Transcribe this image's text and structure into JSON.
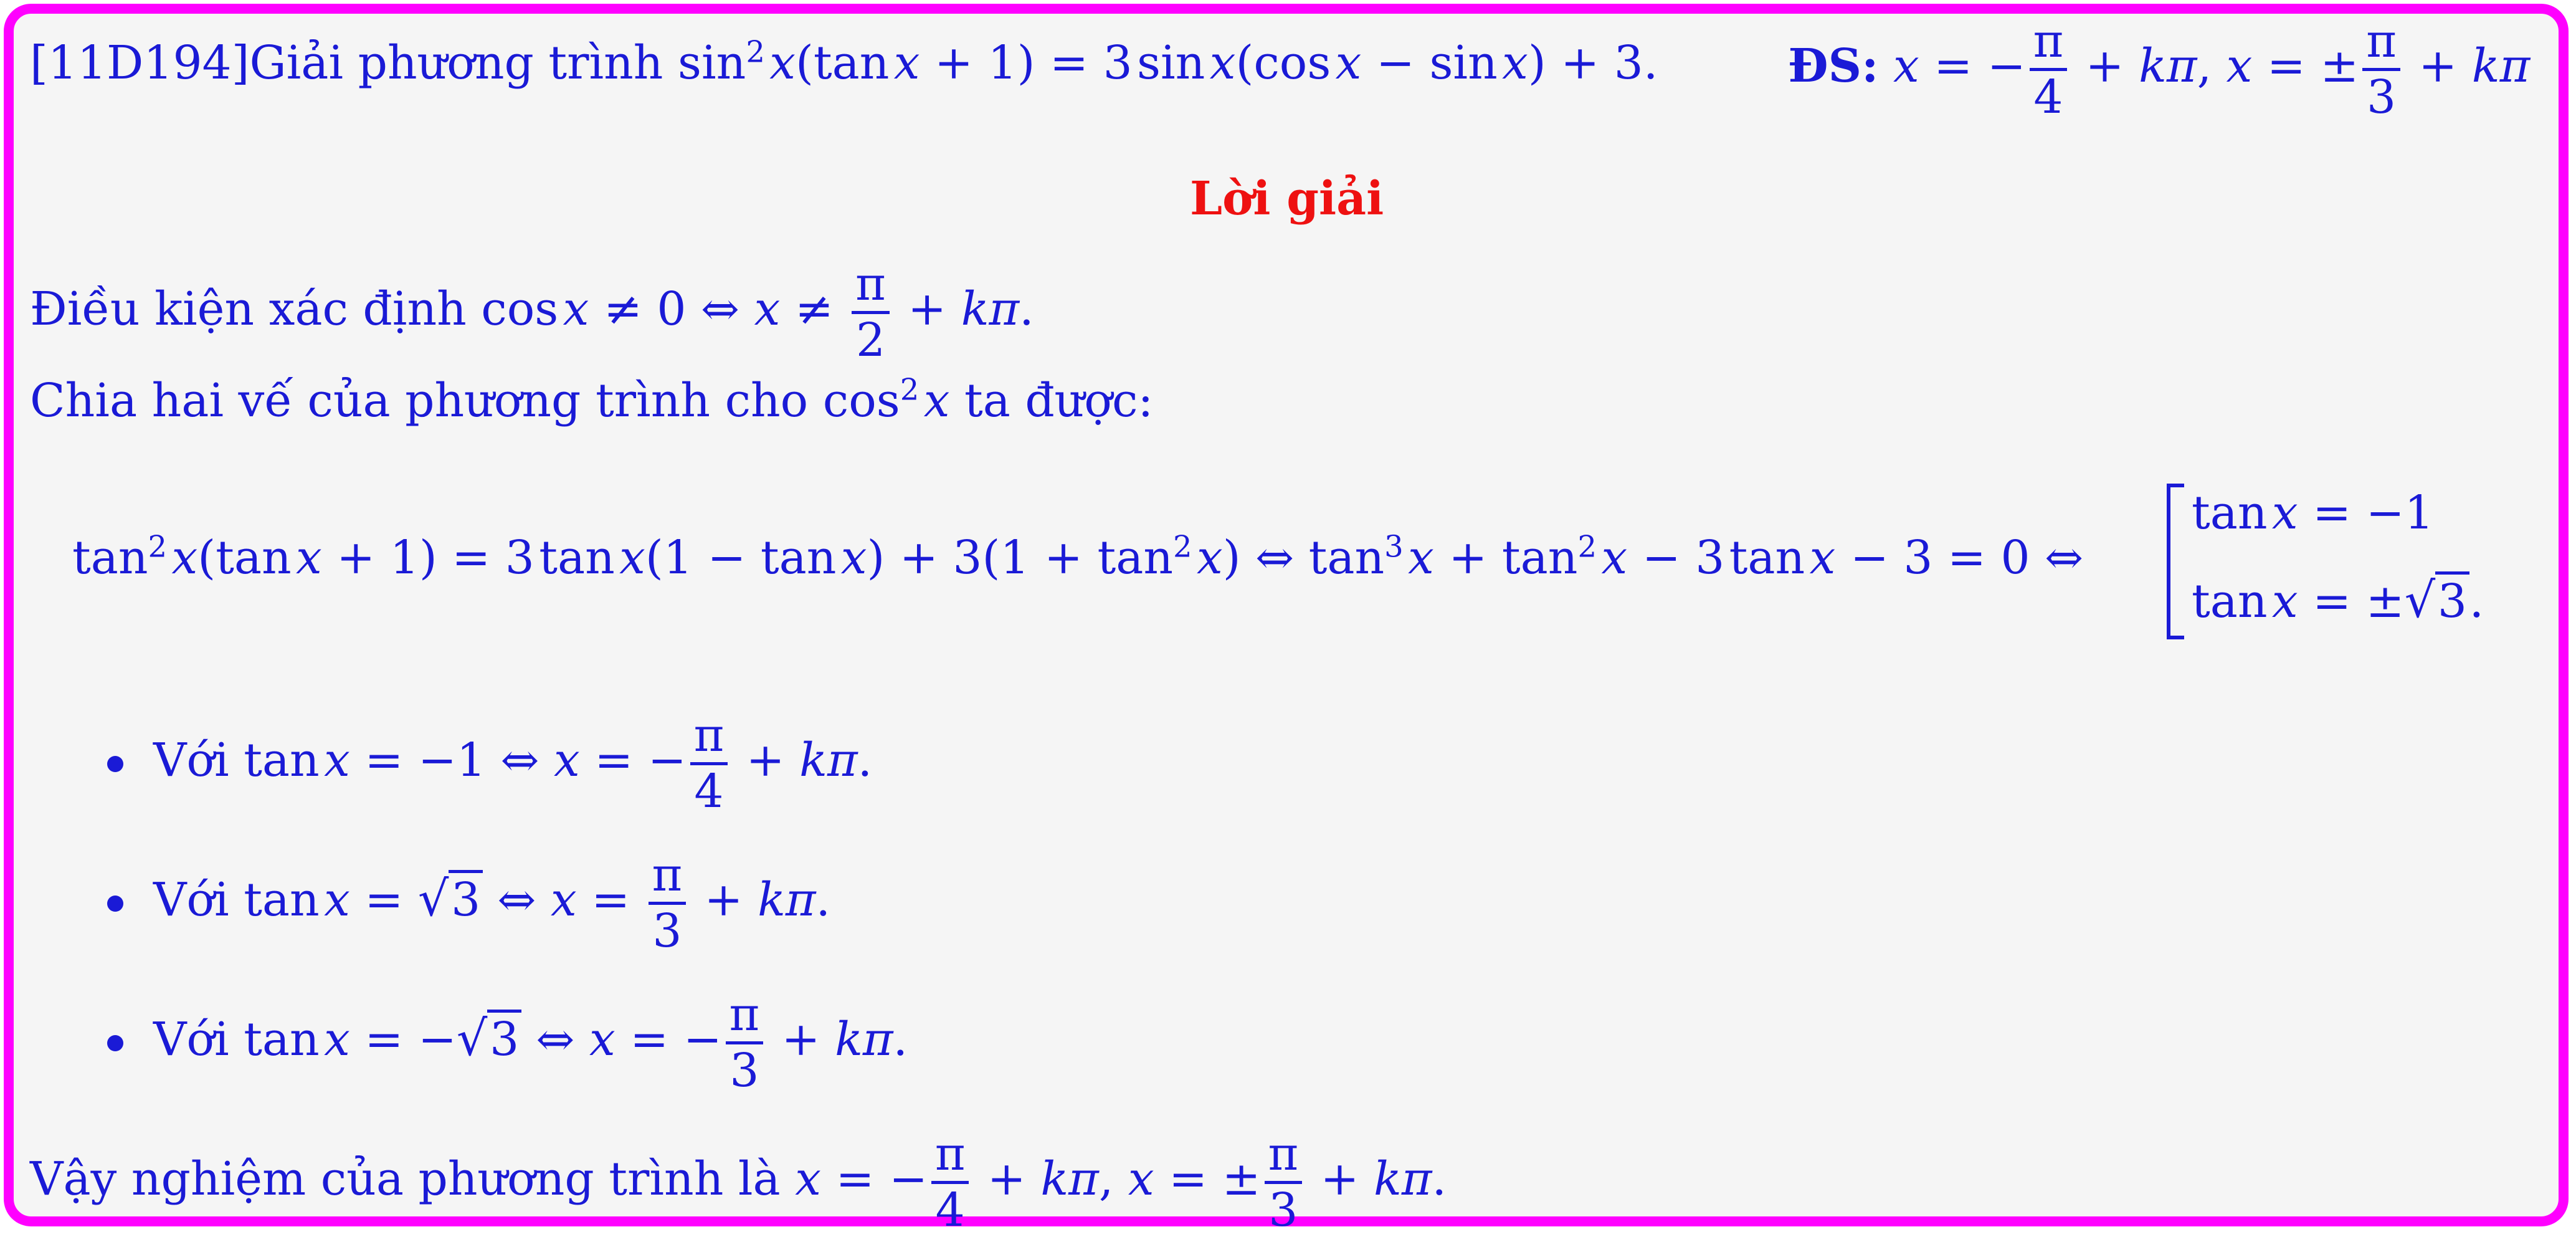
{
  "problem": {
    "code": "[11D194]",
    "intro": "Giải phương trình",
    "answer_label": "ĐS:"
  },
  "solution_heading": "Lời giải",
  "condition_text": "Điều kiện xác định",
  "divide_text_before": "Chia hai vế của phương trình cho",
  "divide_text_after": "ta được:",
  "case_prefix": "Với",
  "conclusion_text": "Vậy nghiệm của phương trình là",
  "colors": {
    "frame_border": "#ff00ff",
    "background": "#f5f5f5",
    "text": "#1a1ad6",
    "heading": "#ee1111"
  }
}
